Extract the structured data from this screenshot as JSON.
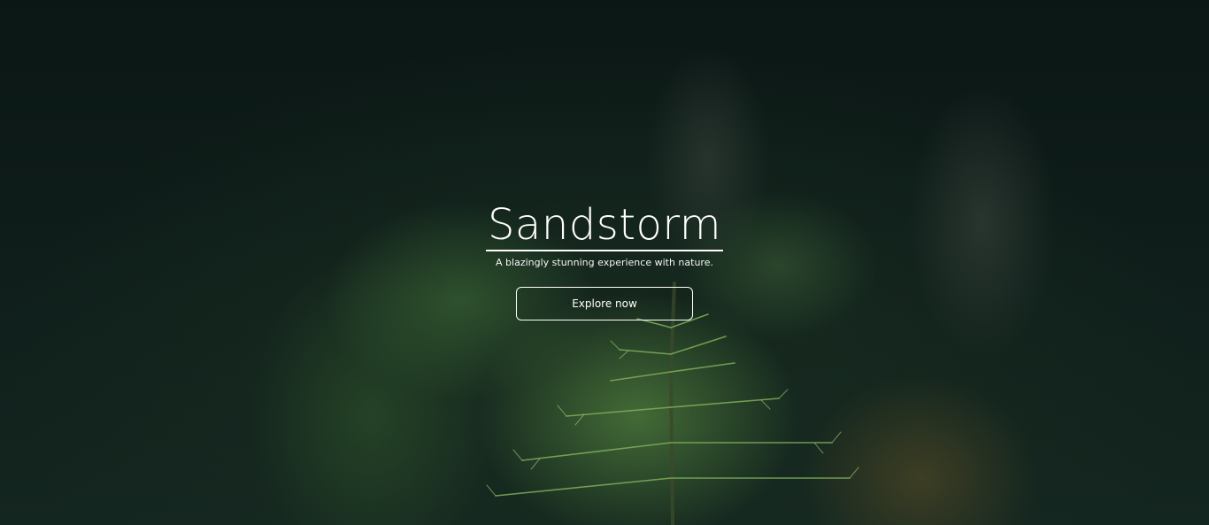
{
  "hero": {
    "title": "Sandstorm",
    "subtitle": "A blazingly stunning experience with nature.",
    "cta_label": "Explore now"
  },
  "colors": {
    "text": "#ffffff",
    "background_dark": "#0d1a17",
    "foliage_green": "#466e37"
  }
}
